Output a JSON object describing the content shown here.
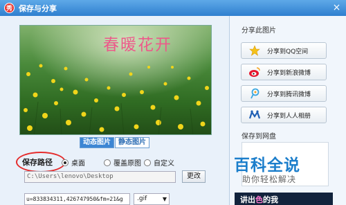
{
  "window": {
    "title": "保存与分享",
    "logo_text": "秀",
    "close": "×"
  },
  "photo": {
    "title": "春暖花开"
  },
  "tabs": [
    {
      "label": "动态图片",
      "active": true
    },
    {
      "label": "静态图片",
      "active": false
    }
  ],
  "save_path": {
    "label": "保存路径",
    "options": [
      {
        "label": "桌面",
        "checked": true
      },
      {
        "label": "覆盖原图",
        "checked": false
      },
      {
        "label": "自定义",
        "checked": false
      }
    ],
    "path_value": "C:\\Users\\lenovo\\Desktop",
    "change_button": "更改"
  },
  "url_field": {
    "value": "u=833834311,426747950&fm=21&g"
  },
  "format_select": {
    "value": ".gif"
  },
  "share": {
    "title": "分享此图片",
    "buttons": [
      {
        "label": "分享到QQ空间",
        "icon": "star-icon"
      },
      {
        "label": "分享到新浪微博",
        "icon": "weibo-icon"
      },
      {
        "label": "分享到腾讯微博",
        "icon": "tencent-weibo-icon"
      },
      {
        "label": "分享到人人相册",
        "icon": "renren-icon"
      }
    ]
  },
  "cloud": {
    "title": "保存到网盘"
  },
  "watermark": {
    "main": "百科全说",
    "sub": "助你轻松解决"
  },
  "promo": {
    "text_left": "讲出",
    "text_accent": "色",
    "text_right": "的我"
  },
  "colors": {
    "title_bar": "#2f7fcf",
    "accent_blue": "#3d86d4",
    "highlight_red": "#e52b2b"
  }
}
